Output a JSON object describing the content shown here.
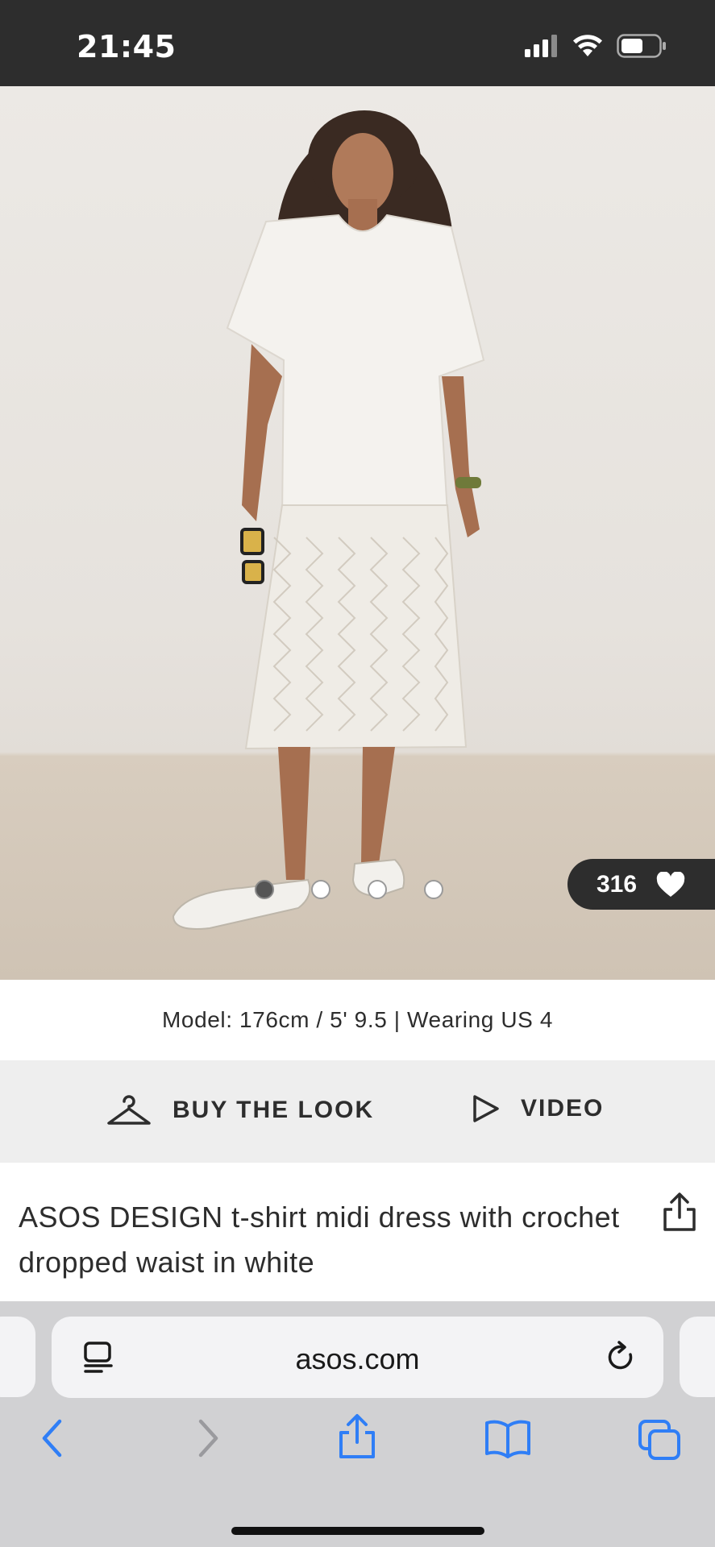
{
  "status_bar": {
    "time": "21:45",
    "icons": [
      "cellular-signal-icon",
      "wifi-icon",
      "battery-icon"
    ]
  },
  "product_image": {
    "alt": "Model wearing white t-shirt midi dress with crochet dropped waist",
    "gallery_total": 4,
    "gallery_active": 1,
    "likes": {
      "count": "316",
      "icon": "heart-icon"
    }
  },
  "model_info": "Model: 176cm / 5' 9.5 | Wearing US 4",
  "actions": {
    "buy_the_look": "BUY THE LOOK",
    "video": "VIDEO"
  },
  "product": {
    "title": "ASOS DESIGN t-shirt midi dress with crochet dropped waist in white"
  },
  "browser": {
    "url": "asos.com",
    "toolbar": [
      "back-icon",
      "forward-icon",
      "share-icon",
      "bookmarks-icon",
      "tabs-icon"
    ]
  },
  "colors": {
    "dark": "#2d2d2d",
    "action_bar_bg": "#eeeeee",
    "safari_blue": "#2f7ef6",
    "disabled_gray": "#9a9a9e"
  }
}
